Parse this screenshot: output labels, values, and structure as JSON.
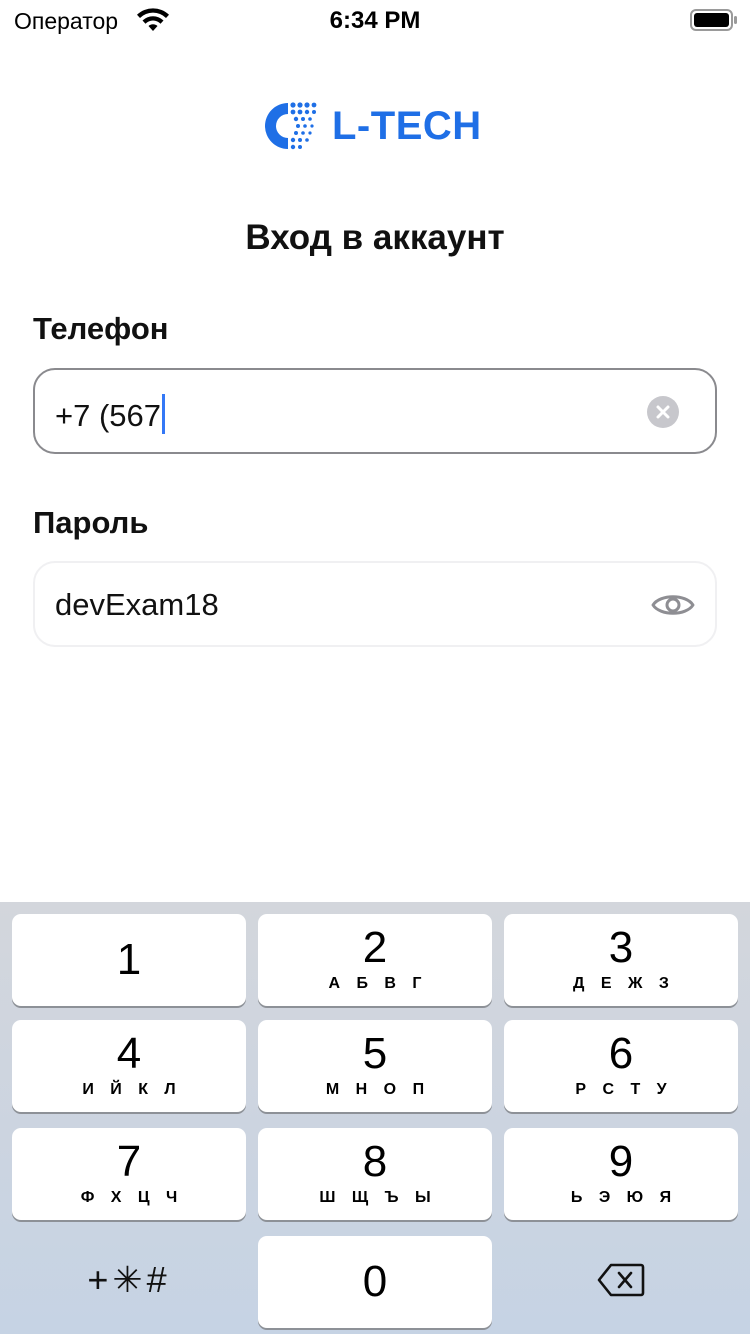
{
  "status_bar": {
    "carrier": "Оператор",
    "time": "6:34 PM"
  },
  "logo": {
    "text": "L-TECH",
    "color": "#1f6fe6"
  },
  "page_title": "Вход в аккаунт",
  "phone": {
    "label": "Телефон",
    "value": "+7 (567",
    "clear_icon": "clear-circle-icon"
  },
  "password": {
    "label": "Пароль",
    "value": "devExam18",
    "toggle_icon": "eye-icon"
  },
  "keyboard": {
    "keys": [
      {
        "digit": "1",
        "letters": ""
      },
      {
        "digit": "2",
        "letters": "А Б В Г"
      },
      {
        "digit": "3",
        "letters": "Д Е Ж З"
      },
      {
        "digit": "4",
        "letters": "И Й К Л"
      },
      {
        "digit": "5",
        "letters": "М Н О П"
      },
      {
        "digit": "6",
        "letters": "Р С Т У"
      },
      {
        "digit": "7",
        "letters": "Ф Х Ц Ч"
      },
      {
        "digit": "8",
        "letters": "Ш Щ Ъ Ы"
      },
      {
        "digit": "9",
        "letters": "Ь Э Ю Я"
      },
      {
        "digit": "0",
        "letters": ""
      }
    ],
    "symbols_label": "+✳#",
    "delete_icon": "backspace-icon"
  }
}
